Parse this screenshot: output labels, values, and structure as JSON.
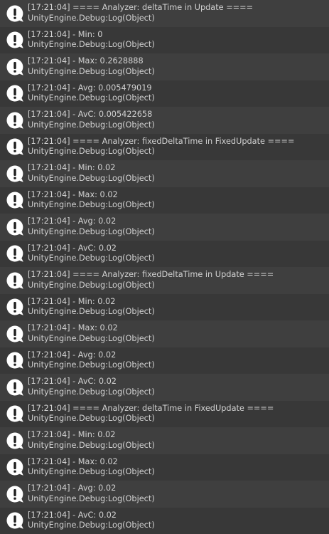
{
  "console": {
    "icon": "info-icon",
    "entries": [
      {
        "message": "[17:21:04] ==== Analyzer: deltaTime in Update ====",
        "source": "UnityEngine.Debug:Log(Object)"
      },
      {
        "message": "[17:21:04] - Min: 0",
        "source": "UnityEngine.Debug:Log(Object)"
      },
      {
        "message": "[17:21:04] - Max: 0.2628888",
        "source": "UnityEngine.Debug:Log(Object)"
      },
      {
        "message": "[17:21:04] - Avg: 0.005479019",
        "source": "UnityEngine.Debug:Log(Object)"
      },
      {
        "message": "[17:21:04] - AvC: 0.005422658",
        "source": "UnityEngine.Debug:Log(Object)"
      },
      {
        "message": "[17:21:04] ==== Analyzer: fixedDeltaTime in FixedUpdate ====",
        "source": "UnityEngine.Debug:Log(Object)"
      },
      {
        "message": "[17:21:04] - Min: 0.02",
        "source": "UnityEngine.Debug:Log(Object)"
      },
      {
        "message": "[17:21:04] - Max: 0.02",
        "source": "UnityEngine.Debug:Log(Object)"
      },
      {
        "message": "[17:21:04] - Avg: 0.02",
        "source": "UnityEngine.Debug:Log(Object)"
      },
      {
        "message": "[17:21:04] - AvC: 0.02",
        "source": "UnityEngine.Debug:Log(Object)"
      },
      {
        "message": "[17:21:04] ==== Analyzer: fixedDeltaTime in Update ====",
        "source": "UnityEngine.Debug:Log(Object)"
      },
      {
        "message": "[17:21:04] - Min: 0.02",
        "source": "UnityEngine.Debug:Log(Object)"
      },
      {
        "message": "[17:21:04] - Max: 0.02",
        "source": "UnityEngine.Debug:Log(Object)"
      },
      {
        "message": "[17:21:04] - Avg: 0.02",
        "source": "UnityEngine.Debug:Log(Object)"
      },
      {
        "message": "[17:21:04] - AvC: 0.02",
        "source": "UnityEngine.Debug:Log(Object)"
      },
      {
        "message": "[17:21:04] ==== Analyzer: deltaTime in FixedUpdate ====",
        "source": "UnityEngine.Debug:Log(Object)"
      },
      {
        "message": "[17:21:04] - Min: 0.02",
        "source": "UnityEngine.Debug:Log(Object)"
      },
      {
        "message": "[17:21:04] - Max: 0.02",
        "source": "UnityEngine.Debug:Log(Object)"
      },
      {
        "message": "[17:21:04] - Avg: 0.02",
        "source": "UnityEngine.Debug:Log(Object)"
      },
      {
        "message": "[17:21:04] - AvC: 0.02",
        "source": "UnityEngine.Debug:Log(Object)"
      }
    ]
  },
  "colors": {
    "row_light": "#3f3f3f",
    "row_dark": "#383838",
    "text": "#d2d2d2",
    "icon_fill": "#ffffff",
    "icon_mark": "#1e1e1e"
  }
}
